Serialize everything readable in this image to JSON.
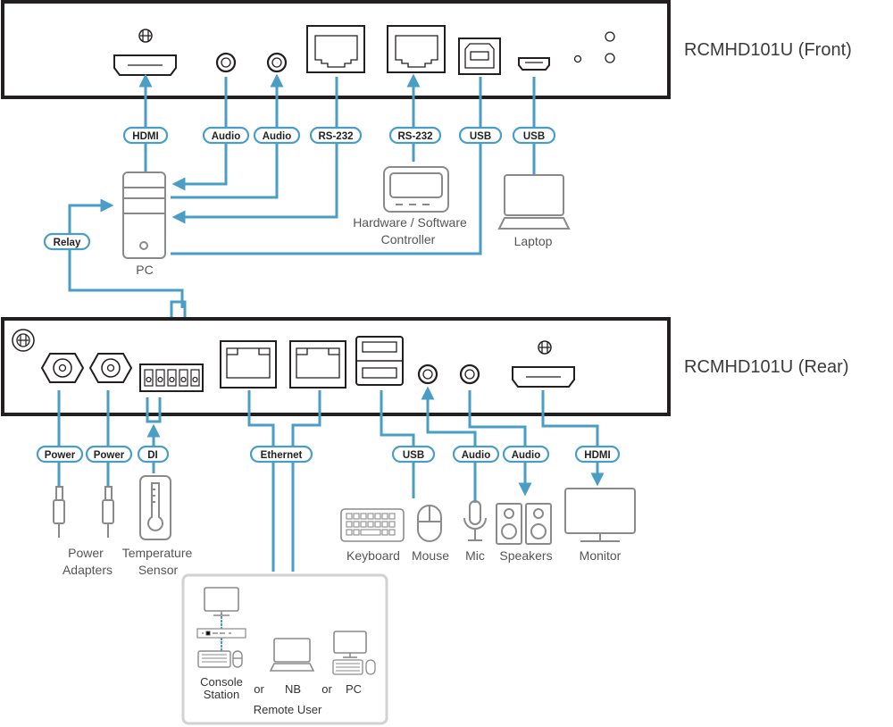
{
  "colors": {
    "cable": "#4a9dc4",
    "panel_border": "#231f20",
    "icon_gray": "#8a8a8a",
    "port_black": "#231f20",
    "caption": "#555555"
  },
  "devices": {
    "front_title": "RCMHD101U (Front)",
    "rear_title": "RCMHD101U (Rear)"
  },
  "front_tags": {
    "hdmi": "HDMI",
    "audio1": "Audio",
    "audio2": "Audio",
    "rs232_1": "RS-232",
    "rs232_2": "RS-232",
    "usb1": "USB",
    "usb2": "USB",
    "relay": "Relay"
  },
  "front_captions": {
    "pc": "PC",
    "controller_line1": "Hardware / Software",
    "controller_line2": "Controller",
    "laptop": "Laptop"
  },
  "rear_tags": {
    "power1": "Power",
    "power2": "Power",
    "di": "DI",
    "ethernet": "Ethernet",
    "usb": "USB",
    "audio1": "Audio",
    "audio2": "Audio",
    "hdmi": "HDMI"
  },
  "rear_captions": {
    "power_line1": "Power",
    "power_line2": "Adapters",
    "temp_line1": "Temperature",
    "temp_line2": "Sensor",
    "keyboard": "Keyboard",
    "mouse": "Mouse",
    "mic": "Mic",
    "speakers": "Speakers",
    "monitor": "Monitor"
  },
  "remote_user": {
    "console_line1": "Console",
    "console_line2": "Station",
    "or1": "or",
    "nb": "NB",
    "or2": "or",
    "pc": "PC",
    "label": "Remote User"
  }
}
